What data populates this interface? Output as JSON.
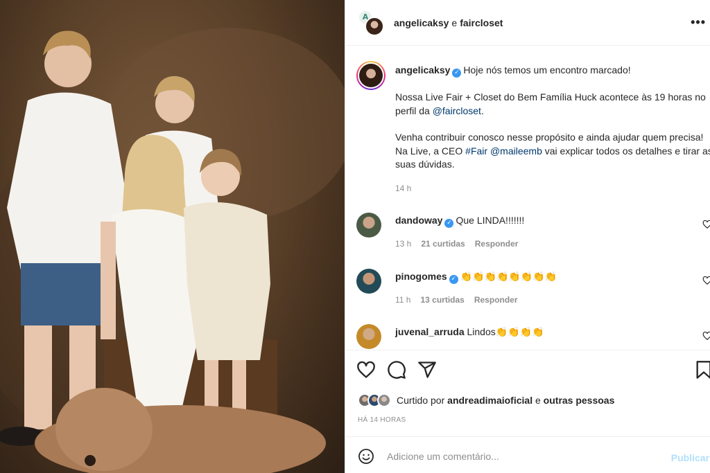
{
  "header": {
    "user1": "angelicaksy",
    "conjunction": "e",
    "user2": "faircloset",
    "more_icon": "more-horizontal-icon"
  },
  "caption": {
    "username": "angelicaksy",
    "line1": "Hoje nós temos um encontro marcado!",
    "p2_text": "Nossa Live Fair + Closet do Bem Família Huck acontece às 19 horas no perfil da ",
    "p2_mention": "@faircloset",
    "p2_end": ".",
    "p3_text1": "Venha contribuir conosco nesse propósito e ainda ajudar quem precisa! Na Live, a CEO ",
    "p3_hashtag": "#Fair",
    "p3_mention": "@maileemb",
    "p3_text2": " vai explicar todos os detalhes e tirar as suas dúvidas.",
    "time": "14 h"
  },
  "comments": [
    {
      "username": "dandoway",
      "verified": true,
      "text": "Que LINDA!!!!!!!",
      "time": "13 h",
      "likes": "21 curtidas",
      "reply": "Responder"
    },
    {
      "username": "pinogomes",
      "verified": true,
      "text": "👏👏👏👏👏👏👏👏",
      "time": "11 h",
      "likes": "13 curtidas",
      "reply": "Responder"
    },
    {
      "username": "juvenal_arruda",
      "verified": false,
      "text": "Lindos👏👏👏👏"
    }
  ],
  "liked": {
    "prefix": "Curtido por",
    "user": "andreadimaioficial",
    "middle": "e",
    "suffix": "outras pessoas"
  },
  "ago": "HÁ 14 HORAS",
  "add_comment": {
    "placeholder": "Adicione um comentário...",
    "publish": "Publicar"
  },
  "colors": {
    "link": "#00376b",
    "verified": "#3897f0",
    "muted": "#8e8e8e",
    "publish": "#b2dffc"
  }
}
